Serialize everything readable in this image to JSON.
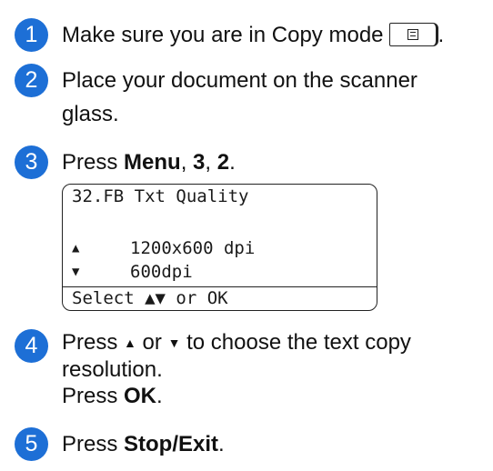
{
  "colors": {
    "badge_blue": "#1d6fd6"
  },
  "steps": [
    {
      "number": "1",
      "text": "Make sure you are in Copy mode",
      "icon": "copy-mode-key-icon"
    },
    {
      "number": "2",
      "line1": "Place your document on the scanner",
      "line2": "glass."
    },
    {
      "number": "3",
      "prefix": "Press ",
      "menu": "Menu",
      "sep1": ", ",
      "key1": "3",
      "sep2": ", ",
      "key2": "2",
      "end": "."
    },
    {
      "number": "4",
      "prefix": "Press ",
      "up": "▲",
      "or": " or ",
      "down": "▼",
      "rest": " to choose the text copy",
      "line2": "resolution.",
      "line3_prefix": "Press ",
      "ok": "OK",
      "line3_end": "."
    },
    {
      "number": "5",
      "prefix": "Press ",
      "key": "Stop/Exit",
      "end": "."
    }
  ],
  "lcd": {
    "title": "32.FB Txt Quality",
    "up_arrow": "▲",
    "down_arrow": "▼",
    "option1": "1200x600 dpi",
    "option2": "600dpi",
    "footer": "Select ▲▼ or OK"
  }
}
